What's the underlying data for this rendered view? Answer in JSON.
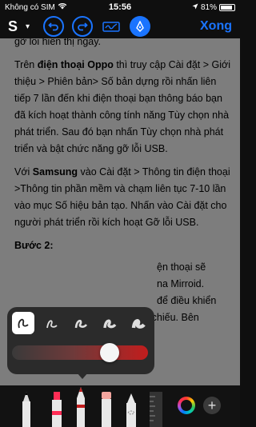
{
  "status_bar": {
    "carrier": "Không có SIM",
    "time": "15:56",
    "battery": "81%"
  },
  "toolbar": {
    "title_initial": "S",
    "done_label": "Xong"
  },
  "document": {
    "partial_top": "gỡ lỗi hiển thị ngay.",
    "oppo_pre": "Trên ",
    "oppo_bold": "điện thoại Oppo",
    "oppo_post": " thì truy cập Cài đặt > Giới thiệu > Phiên bản> Số bản dựng rồi nhấn liên tiếp 7 lần đến khi điện thoại bạn thông báo bạn đã kích hoạt thành công tính năng Tùy chọn nhà phát triển. Sau đó bạn nhấn Tùy chọn nhà phát triển và bật chức năng gỡ lỗi USB.",
    "samsung_pre": "Với ",
    "samsung_bold": "Samsung",
    "samsung_post": " vào Cài đặt > Thông tin điện thoại >Thông tin phần mềm và chạm liên tục 7-10 lần vào mục Số hiệu bản tạo. Nhấn vào Cài đặt cho người phát triển rồi kích hoạt Gỡ lỗi USB.",
    "step2_heading": "Bước 2:",
    "step2_line1": "ện thoại sẽ",
    "step2_line2": "na Mirroid.",
    "step2_line3": "để điều khiển",
    "step2_line4": "và thực hiện các thao tác trình chiếu. Bên"
  },
  "pen_popup": {
    "styles": [
      "pen-style-1",
      "pen-style-2",
      "pen-style-3",
      "pen-style-4",
      "pen-style-5"
    ],
    "selected_style": 0,
    "opacity": 0.75,
    "slider_color": "#c21d1d"
  },
  "tools": {
    "items": [
      {
        "name": "pen-tool",
        "color": "#000000"
      },
      {
        "name": "marker-tool",
        "color": "#ff2d55"
      },
      {
        "name": "pencil-tool",
        "color": "#c21d1d"
      },
      {
        "name": "eraser-tool",
        "color": "#f3a59e"
      },
      {
        "name": "lasso-tool",
        "color": "#ffffff"
      },
      {
        "name": "ruler-tool",
        "color": "#333333"
      }
    ]
  }
}
